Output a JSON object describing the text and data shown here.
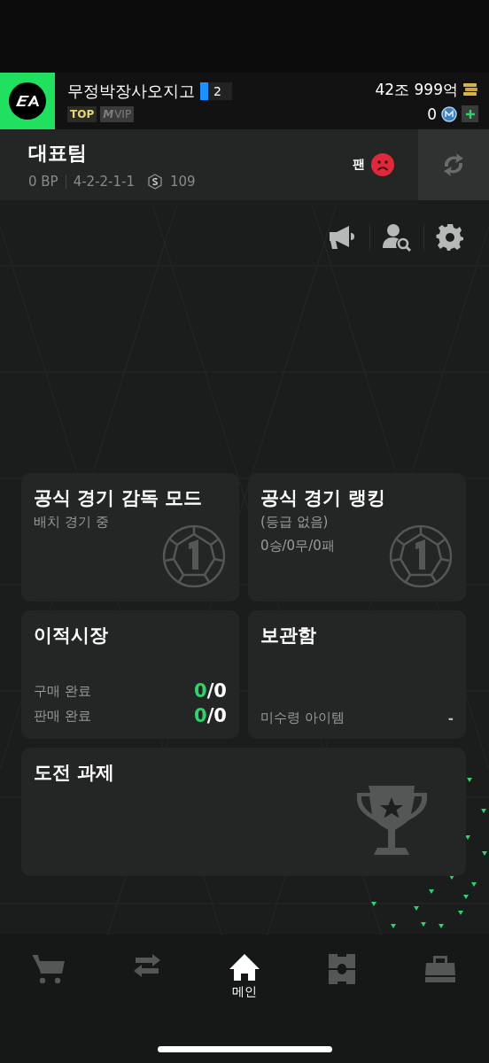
{
  "profile": {
    "name": "무정박장사오지고",
    "level": "2",
    "badges": [
      {
        "label": "TOP",
        "kind": "top"
      },
      {
        "label": "VIP",
        "kind": "vip",
        "prefix": "M"
      }
    ],
    "gold": "42조 999억",
    "points": "0"
  },
  "team": {
    "title": "대표팀",
    "bp": "0 BP",
    "formation": "4-2-2-1-1",
    "salary": "109",
    "fan_label": "팬"
  },
  "toolbar": [
    {
      "kind": "megaphone"
    },
    {
      "kind": "user-search"
    },
    {
      "kind": "settings"
    }
  ],
  "cards": [
    {
      "kind": "ball",
      "title": "공식 경기 감독 모드",
      "lines": [
        "배치 경기 중"
      ]
    },
    {
      "kind": "ball",
      "title": "공식 경기 랭킹",
      "lines": [
        "(등급 없음)",
        "0승/0무/0패"
      ]
    },
    {
      "kind": "transfer",
      "title": "이적시장",
      "rows": [
        {
          "label": "구매 완료",
          "done": "0",
          "rest": "/0"
        },
        {
          "label": "판매 완료",
          "done": "0",
          "rest": "/0"
        }
      ]
    },
    {
      "kind": "storage",
      "title": "보관함",
      "rows": [
        {
          "label": "미수령 아이템",
          "value": "-"
        }
      ]
    },
    {
      "kind": "trophy",
      "title": "도전 과제"
    }
  ],
  "nav": [
    {
      "kind": "cart",
      "selected": false
    },
    {
      "kind": "transfer",
      "selected": false
    },
    {
      "kind": "home",
      "label": "메인",
      "selected": true
    },
    {
      "kind": "pitch",
      "selected": false
    },
    {
      "kind": "bag",
      "selected": false
    }
  ]
}
